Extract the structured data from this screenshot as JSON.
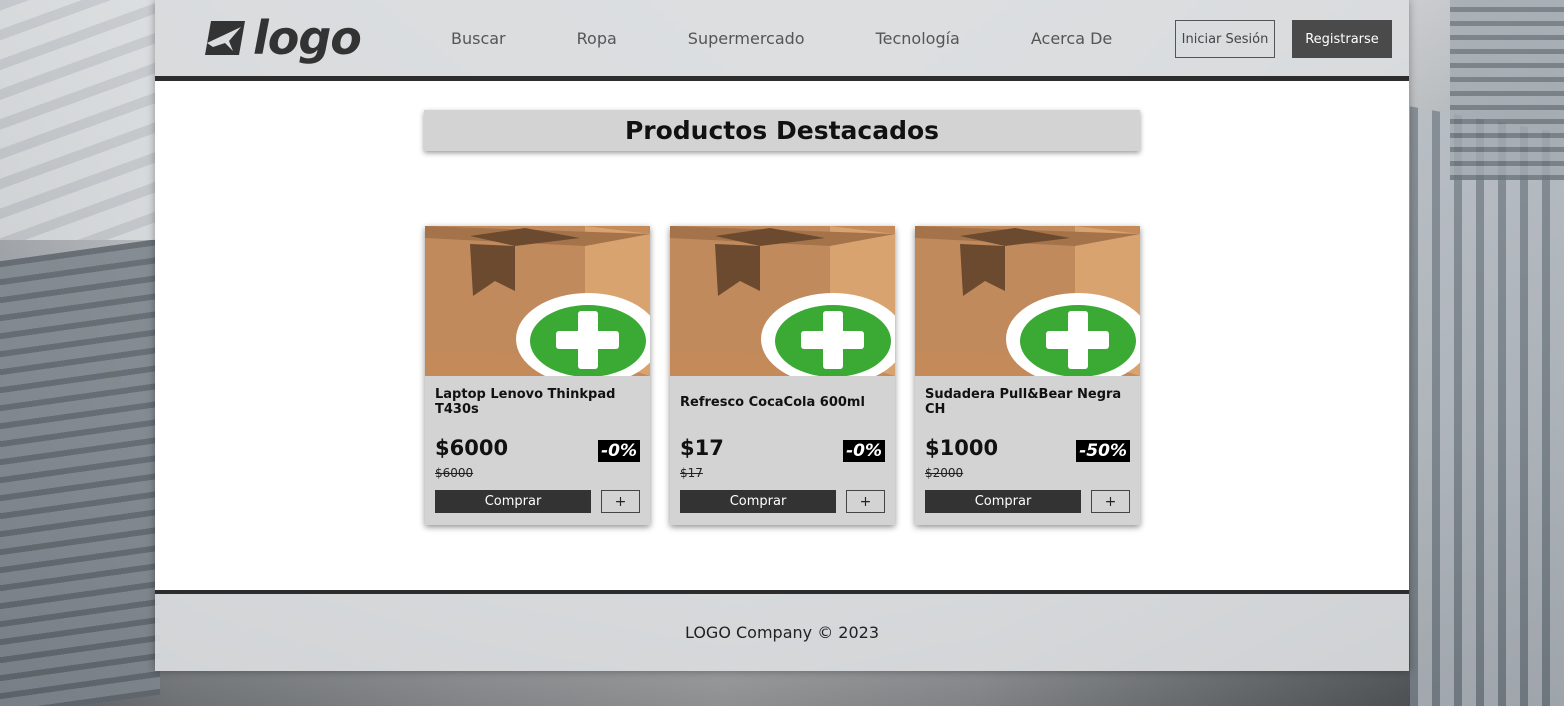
{
  "header": {
    "logo_text": "logo",
    "nav": [
      "Buscar",
      "Ropa",
      "Supermercado",
      "Tecnología",
      "Acerca De"
    ],
    "login_label": "Iniciar Sesión",
    "register_label": "Registrarse"
  },
  "main": {
    "title": "Productos Destacados",
    "products": [
      {
        "name": "Laptop Lenovo Thinkpad T430s",
        "price": "$6000",
        "old_price": "$6000",
        "discount": "-0%",
        "buy_label": "Comprar",
        "add_label": "+"
      },
      {
        "name": "Refresco CocaCola 600ml",
        "price": "$17",
        "old_price": "$17",
        "discount": "-0%",
        "buy_label": "Comprar",
        "add_label": "+"
      },
      {
        "name": "Sudadera Pull&Bear Negra CH",
        "price": "$1000",
        "old_price": "$2000",
        "discount": "-50%",
        "buy_label": "Comprar",
        "add_label": "+"
      }
    ]
  },
  "footer": {
    "text": "LOGO Company © 2023"
  },
  "colors": {
    "header_bg": "#dadcde",
    "dark": "#2d2d2d",
    "card_bg": "#d3d3d3",
    "button_dark": "#333333",
    "plus_green": "#3aaa35",
    "box_brown": "#c48a5a"
  },
  "icons": {
    "logo_mark": "paper-plane-icon",
    "product_image": "box-add-icon"
  }
}
